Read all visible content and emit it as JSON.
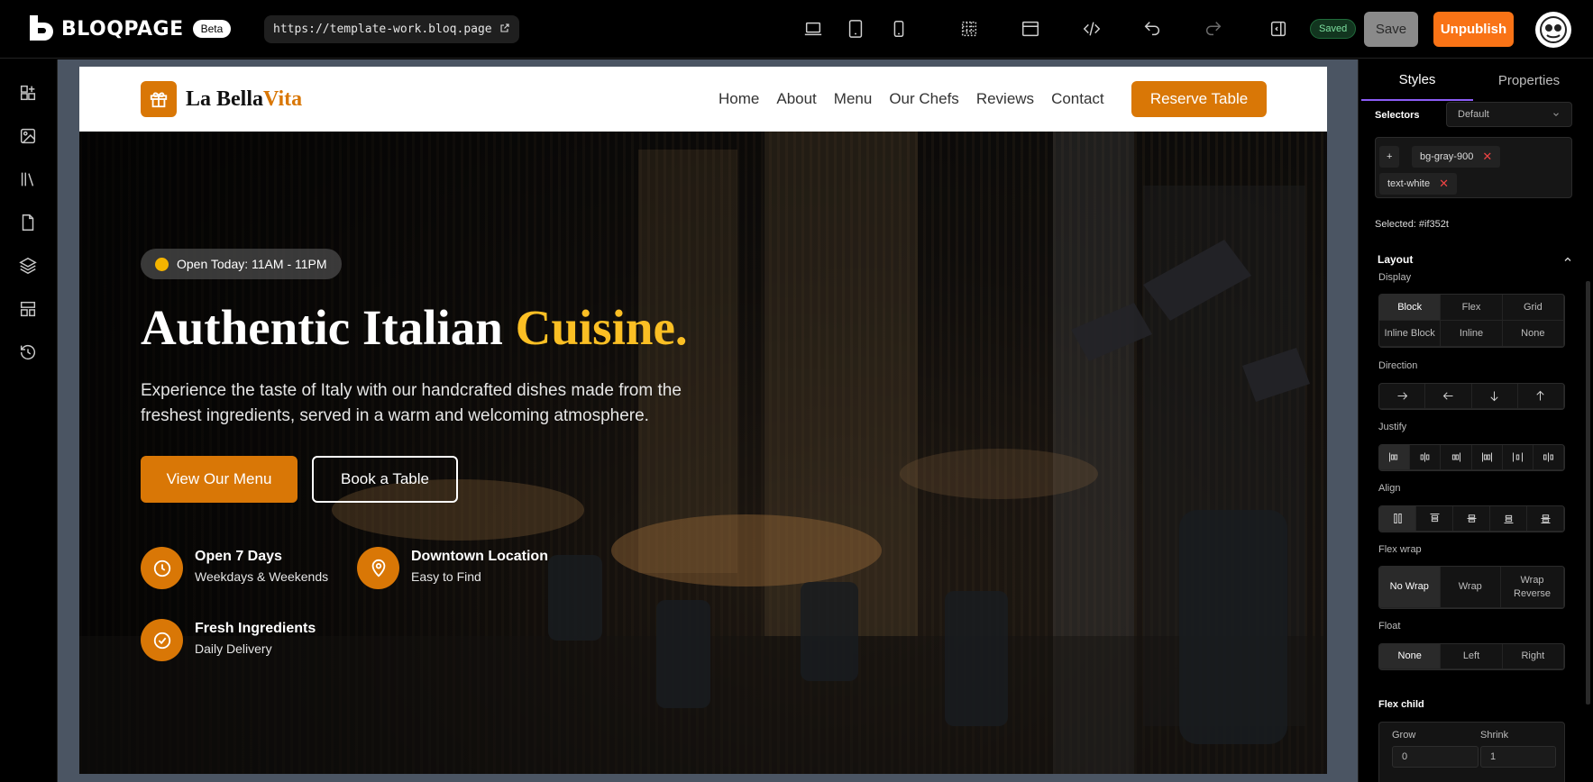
{
  "app": {
    "brand": "BLOQPAGE",
    "beta_badge": "Beta",
    "url": "https://template-work.bloq.page",
    "saved_badge": "Saved",
    "save_label": "Save",
    "unpublish_label": "Unpublish"
  },
  "site": {
    "brand_first": "La Bella",
    "brand_accent": "Vita",
    "nav": [
      "Home",
      "About",
      "Menu",
      "Our Chefs",
      "Reviews",
      "Contact"
    ],
    "reserve_label": "Reserve Table",
    "open_pill": "Open Today: 11AM - 11PM",
    "hero_title": "Authentic Italian ",
    "hero_title_accent": "Cuisine.",
    "hero_subtitle": "Experience the taste of Italy with our handcrafted dishes made from the freshest ingredients, served in a warm and welcoming atmosphere.",
    "menu_button": "View Our Menu",
    "table_button": "Book a Table",
    "features": [
      {
        "title": "Open 7 Days",
        "sub": "Weekdays & Weekends",
        "icon": "clock-icon"
      },
      {
        "title": "Downtown Location",
        "sub": "Easy to Find",
        "icon": "map-pin-icon"
      },
      {
        "title": "Fresh Ingredients",
        "sub": "Daily Delivery",
        "icon": "check-circle-icon"
      }
    ]
  },
  "panel": {
    "tabs": [
      "Styles",
      "Properties"
    ],
    "selectors_label": "Selectors",
    "selectors_state": "Default",
    "chips": [
      "bg-gray-900",
      "text-white"
    ],
    "add_symbol": "+",
    "selected": "Selected: #if352t",
    "layout_title": "Layout",
    "display_label": "Display",
    "display_options": [
      "Block",
      "Flex",
      "Grid",
      "Inline Block",
      "Inline",
      "None"
    ],
    "direction_label": "Direction",
    "justify_label": "Justify",
    "align_label": "Align",
    "flexwrap_label": "Flex wrap",
    "flexwrap_options": [
      "No Wrap",
      "Wrap",
      "Wrap Reverse"
    ],
    "float_label": "Float",
    "float_options": [
      "None",
      "Left",
      "Right"
    ],
    "flexchild_label": "Flex child",
    "grow_label": "Grow",
    "grow_value": "0",
    "shrink_label": "Shrink",
    "shrink_value": "1"
  },
  "colors": {
    "accent_orange": "#d97706",
    "unpublish": "#f97316",
    "title_accent": "#fbbf24",
    "tab_underline": "#8b5cf6"
  }
}
